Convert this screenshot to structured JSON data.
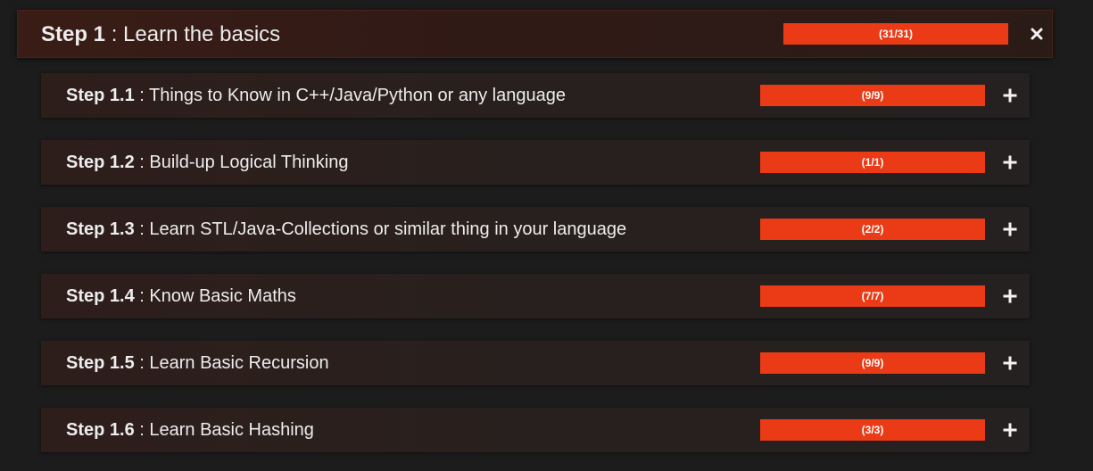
{
  "main": {
    "step_label": "Step 1",
    "separator": " : ",
    "title": "Learn the basics",
    "progress": {
      "done": 31,
      "total": 31,
      "text": "(31/31)",
      "fraction": 1.0
    },
    "close_icon": "close-icon"
  },
  "steps": [
    {
      "label": "Step 1.1",
      "title": "Things to Know in C++/Java/Python or any language",
      "progress_text": "(9/9)",
      "done": 9,
      "total": 9,
      "fraction": 1.0,
      "icon": "plus-icon"
    },
    {
      "label": "Step 1.2",
      "title": "Build-up Logical Thinking",
      "progress_text": "(1/1)",
      "done": 1,
      "total": 1,
      "fraction": 1.0,
      "icon": "plus-icon"
    },
    {
      "label": "Step 1.3",
      "title": "Learn STL/Java-Collections or similar thing in your language",
      "progress_text": "(2/2)",
      "done": 2,
      "total": 2,
      "fraction": 1.0,
      "icon": "plus-icon"
    },
    {
      "label": "Step 1.4",
      "title": "Know Basic Maths",
      "progress_text": "(7/7)",
      "done": 7,
      "total": 7,
      "fraction": 1.0,
      "icon": "plus-icon"
    },
    {
      "label": "Step 1.5",
      "title": "Learn Basic Recursion",
      "progress_text": "(9/9)",
      "done": 9,
      "total": 9,
      "fraction": 1.0,
      "icon": "plus-icon"
    },
    {
      "label": "Step 1.6",
      "title": "Learn Basic Hashing",
      "progress_text": "(3/3)",
      "done": 3,
      "total": 3,
      "fraction": 1.0,
      "icon": "plus-icon"
    }
  ],
  "colors": {
    "accent": "#ea3a16",
    "background": "#1c1c1c",
    "track": "#3b3b3b",
    "text": "#ededed"
  }
}
